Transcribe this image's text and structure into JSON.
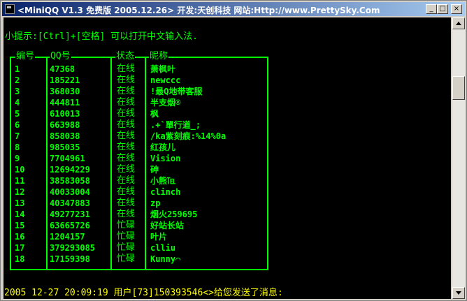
{
  "window": {
    "title": "<MiniQQ V1.3 免费版 2005.12.26> 开发:天创科技 网站:Http://www.PrettySky.Com",
    "buttons": {
      "minimize": "_",
      "maximize": "□",
      "close": "×"
    }
  },
  "console": {
    "hint": "小提示:[Ctrl]+[空格] 可以打开中文输入法.",
    "table": {
      "headers": {
        "no": "编号",
        "qq": "QQ号",
        "status": "状态",
        "nick": "昵称"
      },
      "rows": [
        {
          "no": "1",
          "qq": "47368",
          "status": "在线",
          "nick": "萧枫叶"
        },
        {
          "no": "2",
          "qq": "185221",
          "status": "在线",
          "nick": "newccc"
        },
        {
          "no": "3",
          "qq": "368030",
          "status": "在线",
          "nick": "!最Q地带客服"
        },
        {
          "no": "4",
          "qq": "444811",
          "status": "在线",
          "nick": "半支烟®"
        },
        {
          "no": "5",
          "qq": "610013",
          "status": "在线",
          "nick": "枫"
        },
        {
          "no": "6",
          "qq": "663988",
          "status": "在线",
          "nick": ".+`單行道_;"
        },
        {
          "no": "7",
          "qq": "858038",
          "status": "在线",
          "nick": "/ka紫刻痕:%14%0a"
        },
        {
          "no": "8",
          "qq": "985035",
          "status": "在线",
          "nick": "红孩儿"
        },
        {
          "no": "9",
          "qq": "7704961",
          "status": "在线",
          "nick": "Vision"
        },
        {
          "no": "10",
          "qq": "12694229",
          "status": "在线",
          "nick": "砷"
        },
        {
          "no": "11",
          "qq": "38583058",
          "status": "在线",
          "nick": "小熊℡"
        },
        {
          "no": "12",
          "qq": "40033004",
          "status": "在线",
          "nick": "clinch"
        },
        {
          "no": "13",
          "qq": "40347883",
          "status": "在线",
          "nick": "zp"
        },
        {
          "no": "14",
          "qq": "49277231",
          "status": "在线",
          "nick": "烟火259695"
        },
        {
          "no": "15",
          "qq": "63665726",
          "status": "忙碌",
          "nick": "好站长站"
        },
        {
          "no": "16",
          "qq": "1204157",
          "status": "忙碌",
          "nick": "叶片"
        },
        {
          "no": "17",
          "qq": "379293085",
          "status": "忙碌",
          "nick": "clliu"
        },
        {
          "no": "18",
          "qq": "17159398",
          "status": "忙碌",
          "nick": "Kunny⌒"
        }
      ]
    },
    "status_line": "2005 12-27 20:09:19 用户[73]150393546<>给您发送了消息:"
  },
  "colors": {
    "text": "#00ff00",
    "background": "#000000",
    "status_line": "#ffff00",
    "title_start": "#0a246a",
    "title_end": "#a6caf0"
  },
  "icons": {
    "app": "console-icon",
    "scroll_up": "arrow-up-icon",
    "scroll_down": "arrow-down-icon"
  }
}
